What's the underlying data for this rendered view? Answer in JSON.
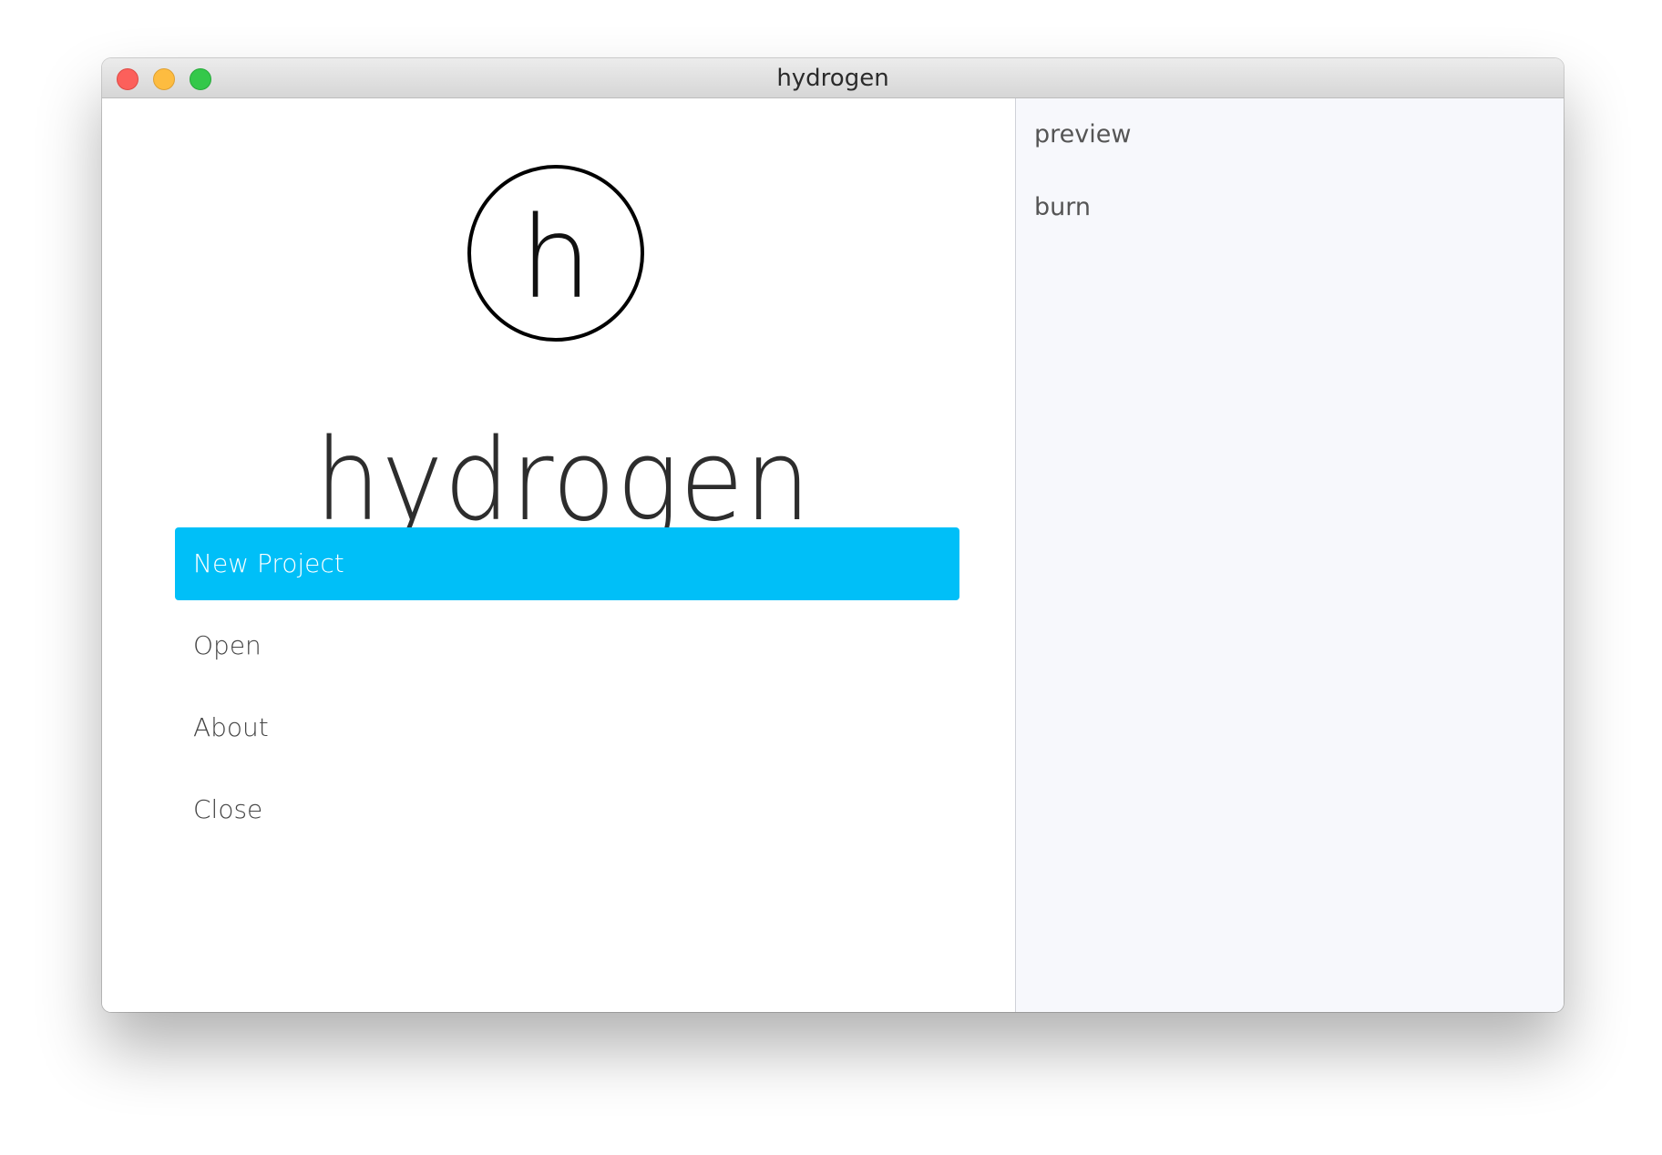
{
  "window": {
    "title": "hydrogen"
  },
  "brand": {
    "logo_letter": "h",
    "name": "hydrogen",
    "accent": "#00bff8"
  },
  "menu": {
    "items": [
      {
        "label": "New Project",
        "active": true
      },
      {
        "label": "Open",
        "active": false
      },
      {
        "label": "About",
        "active": false
      },
      {
        "label": "Close",
        "active": false
      }
    ]
  },
  "sidebar": {
    "items": [
      {
        "label": "preview"
      },
      {
        "label": "burn"
      }
    ]
  }
}
